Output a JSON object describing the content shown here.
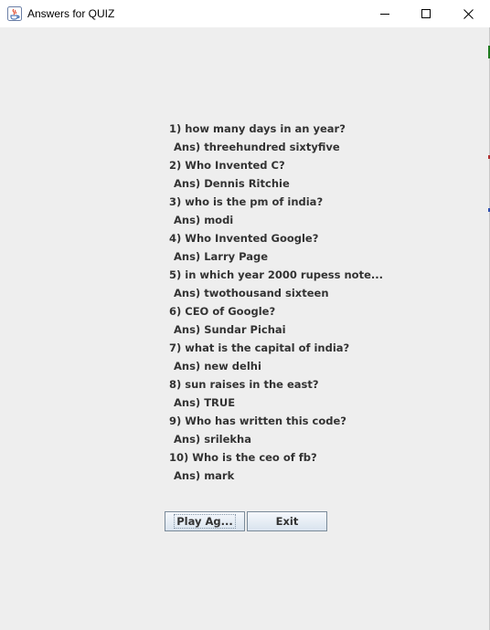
{
  "window": {
    "title": "Answers for QUIZ",
    "controls": {
      "minimize": "minimize",
      "maximize": "maximize",
      "close": "close"
    }
  },
  "answers": [
    {
      "question": "1) how many days in an year?",
      "answer": "Ans) threehundred sixtyfive"
    },
    {
      "question": "2) Who Invented C?",
      "answer": "Ans) Dennis Ritchie"
    },
    {
      "question": "3) who is the pm of india?",
      "answer": "Ans) modi"
    },
    {
      "question": "4) Who Invented Google?",
      "answer": "Ans) Larry Page"
    },
    {
      "question": "5) in which year 2000 rupess note...",
      "answer": "Ans) twothousand sixteen"
    },
    {
      "question": "6) CEO of Google?",
      "answer": "Ans) Sundar Pichai"
    },
    {
      "question": "7) what is the capital of india?",
      "answer": "Ans) new delhi"
    },
    {
      "question": "8) sun raises in the east?",
      "answer": "Ans) TRUE"
    },
    {
      "question": "9) Who has written this code?",
      "answer": "Ans) srilekha"
    },
    {
      "question": "10) Who is the ceo of fb?",
      "answer": "Ans) mark"
    }
  ],
  "buttons": {
    "play_again": "Play Ag...",
    "exit": "Exit"
  },
  "colors": {
    "background": "#eeeeee",
    "titlebar": "#ffffff",
    "text": "#333333",
    "button_border": "#7a8a99"
  }
}
